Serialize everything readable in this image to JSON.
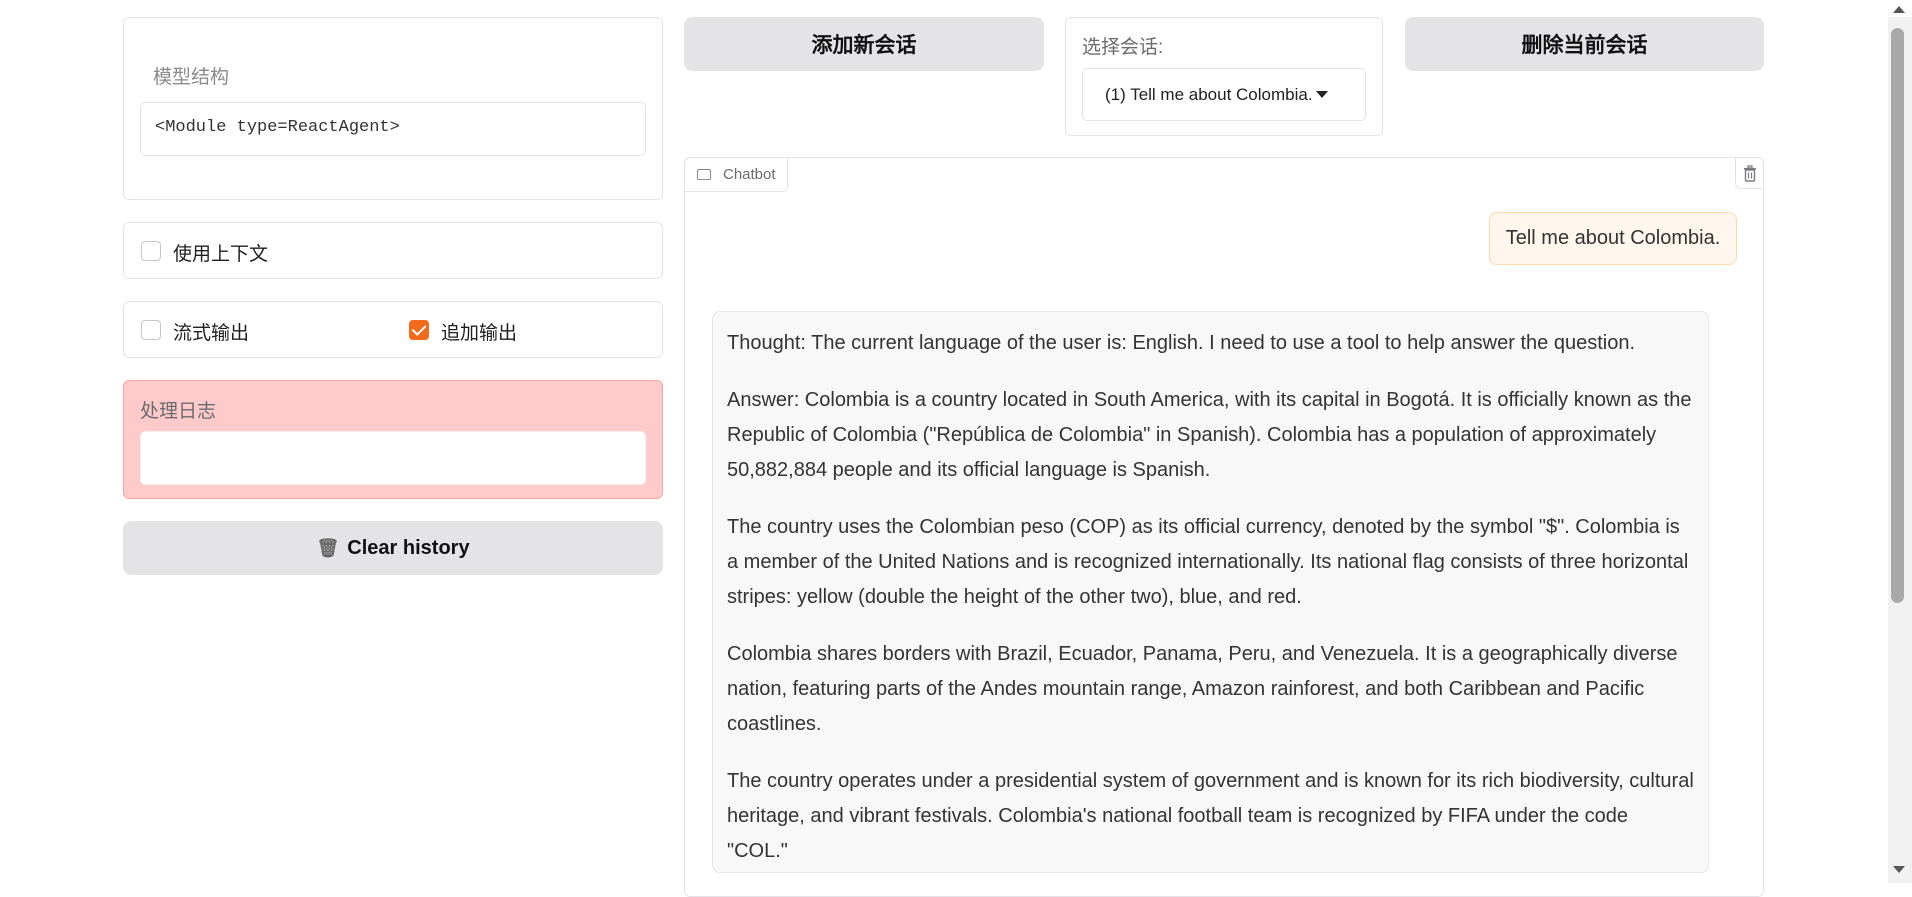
{
  "left_panel": {
    "model_label": "模型结构",
    "model_value": "<Module type=ReactAgent>",
    "use_context_label": "使用上下文",
    "use_context_checked": false,
    "stream_output_label": "流式输出",
    "stream_output_checked": false,
    "append_output_label": "追加输出",
    "append_output_checked": true,
    "log_label": "处理日志",
    "log_value": "",
    "clear_history_label": "Clear history",
    "clear_history_icon": "trash-icon"
  },
  "toolbar": {
    "add_session_label": "添加新会话",
    "select_session_label": "选择会话:",
    "selected_session": "(1)  Tell me about Colombia.",
    "delete_session_label": "删除当前会话"
  },
  "chatbot": {
    "tab_label": "Chatbot",
    "user_message": "Tell me about Colombia.",
    "bot_paragraphs": [
      "Thought: The current language of the user is: English. I need to use a tool to help answer the question.",
      "Answer: Colombia is a country located in South America, with its capital in Bogotá. It is officially known as the Republic of Colombia (\"República de Colombia\" in Spanish). Colombia has a population of approximately 50,882,884 people and its official language is Spanish.",
      "The country uses the Colombian peso (COP) as its official currency, denoted by the symbol \"$\". Colombia is a member of the United Nations and is recognized internationally. Its national flag consists of three horizontal stripes: yellow (double the height of the other two), blue, and red.",
      "Colombia shares borders with Brazil, Ecuador, Panama, Peru, and Venezuela. It is a geographically diverse nation, featuring parts of the Andes mountain range, Amazon rainforest, and both Caribbean and Pacific coastlines.",
      "The country operates under a presidential system of government and is known for its rich biodiversity, cultural heritage, and vibrant festivals. Colombia's national football team is recognized by FIFA under the code \"COL.\""
    ]
  },
  "colors": {
    "accent": "#f26a1b",
    "log_background": "#fecaca",
    "user_bubble": "#fff6ed",
    "button_background": "#e4e4e7"
  }
}
